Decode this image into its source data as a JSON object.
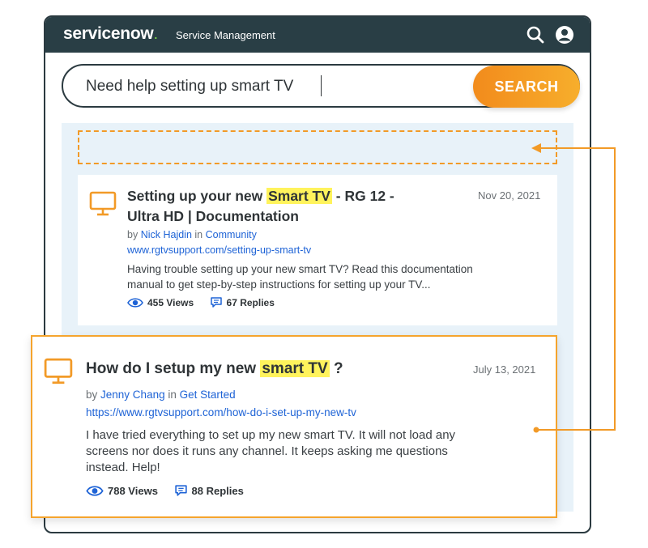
{
  "header": {
    "logo_text": "servicenow",
    "logo_dot": ".",
    "product": "Service Management"
  },
  "search": {
    "query": "Need help setting up smart TV",
    "button_label": "SEARCH"
  },
  "results": [
    {
      "title_before": "Setting up your new ",
      "title_highlight": "Smart TV",
      "title_after_line1": " - RG 12 -",
      "title_line2": "Ultra HD | Documentation",
      "date": "Nov 20, 2021",
      "by_label": "by",
      "author": "Nick Hajdin",
      "in_label": "in",
      "category": "Community",
      "url": "www.rgtvsupport.com/setting-up-smart-tv",
      "excerpt_line1": "Having trouble setting up your new smart TV? Read this documentation",
      "excerpt_line2": "manual to get step-by-step instructions for setting up your TV...",
      "views": "455 Views",
      "replies": "67 Replies"
    },
    {
      "title_before": "How do I setup my new ",
      "title_highlight": "smart TV",
      "title_after": " ?",
      "date": "July 13, 2021",
      "by_label": "by",
      "author": "Jenny Chang",
      "in_label": "in",
      "category": "Get Started",
      "url": "https://www.rgtvsupport.com/how-do-i-set-up-my-new-tv",
      "excerpt_line1": "I have tried everything to set up my new smart TV. It will not load any",
      "excerpt_line2": "screens nor does it runs any channel. It keeps asking me questions",
      "excerpt_line3": "instead. Help!",
      "views": "788 Views",
      "replies": "88 Replies"
    }
  ],
  "colors": {
    "header_bg": "#293e45",
    "accent_orange": "#f29a27",
    "highlight": "#fff35c",
    "link": "#1e63d6",
    "panel_bg": "#e8f2f9"
  },
  "icons": [
    "search-icon",
    "user-avatar-icon",
    "tv-icon",
    "eye-icon",
    "comment-icon"
  ]
}
